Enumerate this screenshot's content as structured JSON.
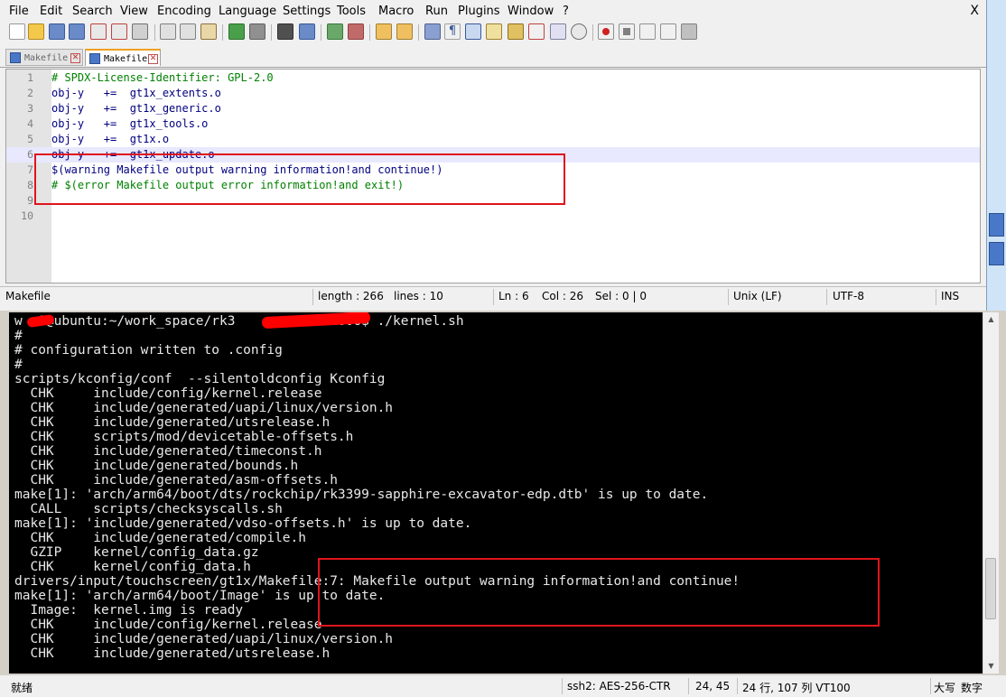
{
  "menu": [
    "File",
    "Edit",
    "Search",
    "View",
    "Encoding",
    "Language",
    "Settings",
    "Tools",
    "Macro",
    "Run",
    "Plugins",
    "Window",
    "?"
  ],
  "window_close": "X",
  "tabs": [
    {
      "label": "Makefile",
      "close": "✕",
      "active": false
    },
    {
      "label": "Makefile",
      "close": "✕",
      "active": true
    }
  ],
  "editor": {
    "lines": [
      {
        "num": "1",
        "text": "# SPDX-License-Identifier: GPL-2.0",
        "style": "comment"
      },
      {
        "num": "2",
        "text": "obj-y   +=  gt1x_extents.o",
        "style": "code"
      },
      {
        "num": "3",
        "text": "obj-y   +=  gt1x_generic.o",
        "style": "code"
      },
      {
        "num": "4",
        "text": "obj-y   +=  gt1x_tools.o",
        "style": "code"
      },
      {
        "num": "5",
        "text": "obj-y   +=  gt1x.o",
        "style": "code"
      },
      {
        "num": "6",
        "text": "obj-y   +=  gt1x_update.o",
        "style": "code"
      },
      {
        "num": "7",
        "text": "$(warning Makefile output warning information!and continue!)",
        "style": "code"
      },
      {
        "num": "8",
        "text": "# $(error Makefile output error information!and exit!)",
        "style": "comment"
      },
      {
        "num": "9",
        "text": "",
        "style": "code"
      },
      {
        "num": "10",
        "text": "",
        "style": "code"
      }
    ]
  },
  "status": {
    "file_type": "Makefile",
    "length": "length : 266",
    "lines": "lines : 10",
    "ln": "Ln : 6",
    "col": "Col : 26",
    "sel": "Sel : 0 | 0",
    "eol": "Unix (LF)",
    "encoding": "UTF-8",
    "mode": "INS"
  },
  "terminal": {
    "lines": [
      "w  1@ubuntu:~/work_space/rk3           .2606$ ./kernel.sh",
      "#",
      "# configuration written to .config",
      "#",
      "scripts/kconfig/conf  --silentoldconfig Kconfig",
      "  CHK     include/config/kernel.release",
      "  CHK     include/generated/uapi/linux/version.h",
      "  CHK     include/generated/utsrelease.h",
      "  CHK     scripts/mod/devicetable-offsets.h",
      "  CHK     include/generated/timeconst.h",
      "  CHK     include/generated/bounds.h",
      "  CHK     include/generated/asm-offsets.h",
      "make[1]: 'arch/arm64/boot/dts/rockchip/rk3399-sapphire-excavator-edp.dtb' is up to date.",
      "  CALL    scripts/checksyscalls.sh",
      "make[1]: 'include/generated/vdso-offsets.h' is up to date.",
      "  CHK     include/generated/compile.h",
      "  GZIP    kernel/config_data.gz",
      "  CHK     kernel/config_data.h",
      "drivers/input/touchscreen/gt1x/Makefile:7: Makefile output warning information!and continue!",
      "make[1]: 'arch/arm64/boot/Image' is up to date.",
      "  Image:  kernel.img is ready",
      "  CHK     include/config/kernel.release",
      "  CHK     include/generated/uapi/linux/version.h",
      "  CHK     include/generated/utsrelease.h"
    ]
  },
  "term_status": {
    "left": "就绪",
    "cipher": "ssh2: AES-256-CTR",
    "cursor": "24,  45",
    "size": "24 行, 107 列 VT100",
    "caps": "大写",
    "num": "数字"
  },
  "colors": {
    "highlight_box": "#e0141c",
    "terminal_bg": "#000000",
    "comment": "#008000",
    "code": "#000080"
  }
}
